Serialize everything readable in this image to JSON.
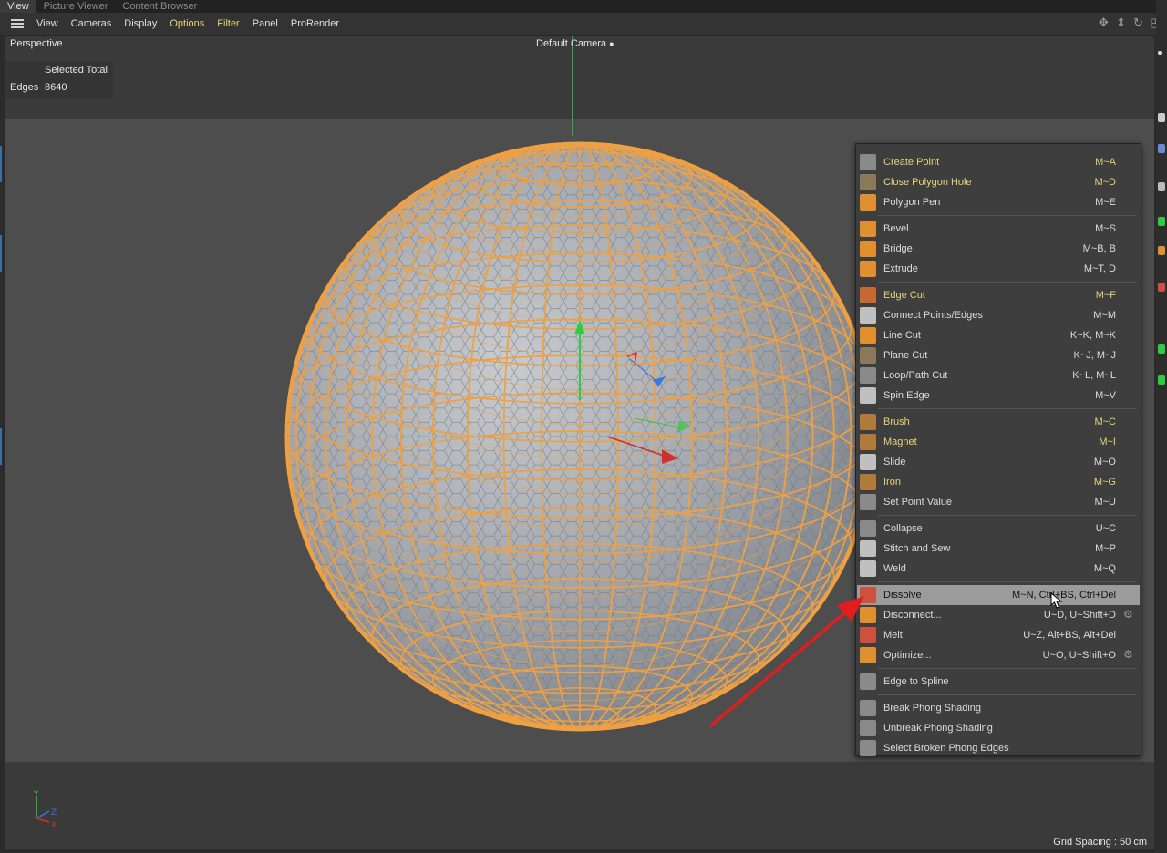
{
  "tabs": [
    "View",
    "Picture Viewer",
    "Content Browser"
  ],
  "menu": [
    "View",
    "Cameras",
    "Display",
    "Options",
    "Filter",
    "Panel",
    "ProRender"
  ],
  "viewport": {
    "name": "Perspective",
    "camera": "Default Camera",
    "camera_icon": "video-camera-icon",
    "stats": {
      "header": "Selected Total",
      "label": "Edges",
      "value": "8640"
    },
    "grid_spacing": "Grid Spacing : 50 cm",
    "axis_labels": {
      "y": "Y",
      "z": "Z",
      "x": "X"
    }
  },
  "popup": {
    "groups": [
      [
        {
          "label": "Create Point",
          "key": "M~A",
          "highlight": true,
          "icon": "create-point-icon",
          "color": "#8a8a8a"
        },
        {
          "label": "Close Polygon Hole",
          "key": "M~D",
          "highlight": true,
          "icon": "close-polygon-hole-icon",
          "color": "#8a7a5a"
        },
        {
          "label": "Polygon Pen",
          "key": "M~E",
          "highlight": false,
          "icon": "polygon-pen-icon",
          "color": "#e0902e"
        }
      ],
      [
        {
          "label": "Bevel",
          "key": "M~S",
          "highlight": false,
          "icon": "bevel-icon",
          "color": "#e0902e"
        },
        {
          "label": "Bridge",
          "key": "M~B, B",
          "highlight": false,
          "icon": "bridge-icon",
          "color": "#e0902e"
        },
        {
          "label": "Extrude",
          "key": "M~T, D",
          "highlight": false,
          "icon": "extrude-icon",
          "color": "#e0902e"
        }
      ],
      [
        {
          "label": "Edge Cut",
          "key": "M~F",
          "highlight": true,
          "icon": "edge-cut-icon",
          "color": "#c86a30"
        },
        {
          "label": "Connect Points/Edges",
          "key": "M~M",
          "highlight": false,
          "icon": "connect-points-icon",
          "color": "#c0c0c0"
        },
        {
          "label": "Line Cut",
          "key": "K~K, M~K",
          "highlight": false,
          "icon": "line-cut-icon",
          "color": "#e0902e"
        },
        {
          "label": "Plane Cut",
          "key": "K~J, M~J",
          "highlight": false,
          "icon": "plane-cut-icon",
          "color": "#8a7a5a"
        },
        {
          "label": "Loop/Path Cut",
          "key": "K~L, M~L",
          "highlight": false,
          "icon": "loop-path-cut-icon",
          "color": "#8a8a8a"
        },
        {
          "label": "Spin Edge",
          "key": "M~V",
          "highlight": false,
          "icon": "spin-edge-icon",
          "color": "#c0c0c0"
        }
      ],
      [
        {
          "label": "Brush",
          "key": "M~C",
          "highlight": true,
          "icon": "brush-icon",
          "color": "#b07a3a"
        },
        {
          "label": "Magnet",
          "key": "M~I",
          "highlight": true,
          "icon": "magnet-icon",
          "color": "#b07a3a"
        },
        {
          "label": "Slide",
          "key": "M~O",
          "highlight": false,
          "icon": "slide-icon",
          "color": "#c0c0c0"
        },
        {
          "label": "Iron",
          "key": "M~G",
          "highlight": true,
          "icon": "iron-icon",
          "color": "#b07a3a"
        },
        {
          "label": "Set Point Value",
          "key": "M~U",
          "highlight": false,
          "icon": "set-point-value-icon",
          "color": "#8a8a8a"
        }
      ],
      [
        {
          "label": "Collapse",
          "key": "U~C",
          "highlight": false,
          "icon": "collapse-icon",
          "color": "#8a8a8a"
        },
        {
          "label": "Stitch and Sew",
          "key": "M~P",
          "highlight": false,
          "icon": "stitch-sew-icon",
          "color": "#c0c0c0"
        },
        {
          "label": "Weld",
          "key": "M~Q",
          "highlight": false,
          "icon": "weld-icon",
          "color": "#c0c0c0"
        }
      ],
      [
        {
          "label": "Dissolve",
          "key": "M~N, Ctrl+BS, Ctrl+Del",
          "highlight": false,
          "selected": true,
          "icon": "dissolve-icon",
          "color": "#d05040"
        },
        {
          "label": "Disconnect...",
          "key": "U~D, U~Shift+D",
          "highlight": false,
          "gear": true,
          "icon": "disconnect-icon",
          "color": "#e0902e"
        },
        {
          "label": "Melt",
          "key": "U~Z, Alt+BS, Alt+Del",
          "highlight": false,
          "icon": "melt-icon",
          "color": "#d05040"
        },
        {
          "label": "Optimize...",
          "key": "U~O, U~Shift+O",
          "highlight": false,
          "gear": true,
          "icon": "optimize-icon",
          "color": "#e0902e"
        }
      ],
      [
        {
          "label": "Edge to Spline",
          "key": "",
          "highlight": false,
          "icon": "edge-to-spline-icon",
          "color": "#8a8a8a"
        }
      ],
      [
        {
          "label": "Break Phong Shading",
          "key": "",
          "highlight": false,
          "icon": "break-phong-icon",
          "color": "#8a8a8a"
        },
        {
          "label": "Unbreak Phong Shading",
          "key": "",
          "highlight": false,
          "icon": "unbreak-phong-icon",
          "color": "#8a8a8a"
        },
        {
          "label": "Select Broken Phong Edges",
          "key": "",
          "highlight": false,
          "icon": "select-broken-phong-icon",
          "color": "#8a8a8a"
        }
      ]
    ]
  },
  "colors": {
    "accent": "#e7d37a",
    "wire": "#f0a040",
    "sphere_fill": "#a9adb2",
    "annotation_arrow": "#e01e1e"
  }
}
